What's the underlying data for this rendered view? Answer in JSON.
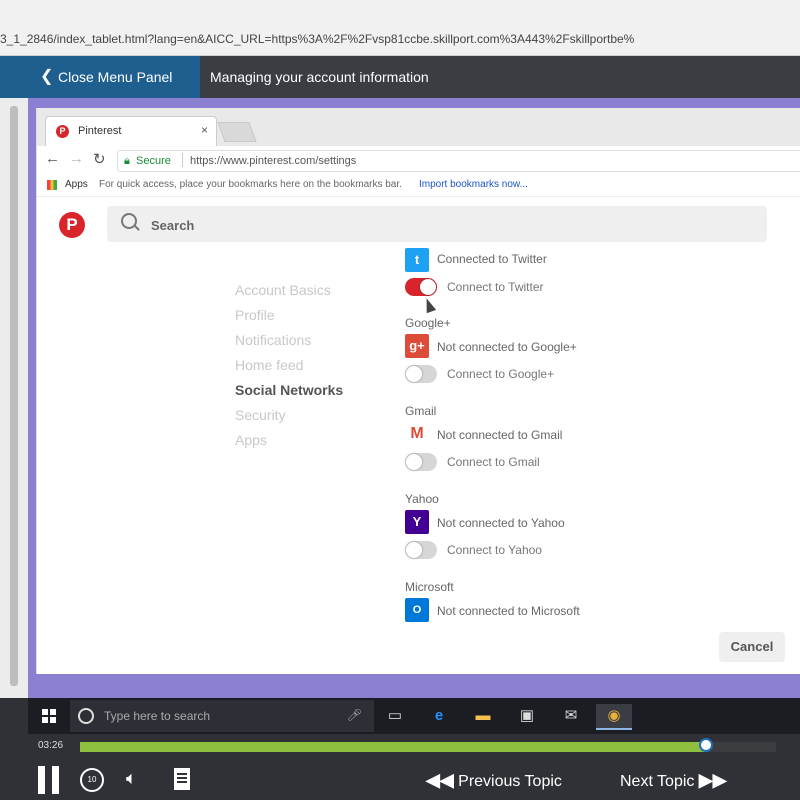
{
  "browser": {
    "url": "3_1_2846/index_tablet.html?lang=en&AICC_URL=https%3A%2F%2Fvsp81ccbe.skillport.com%3A443%2Fskillportbe%"
  },
  "course": {
    "close_menu_label": "Close Menu Panel",
    "title": "Managing your account information"
  },
  "inner_browser": {
    "tab_title": "Pinterest",
    "tab_close": "×",
    "secure_label": "Secure",
    "address": "https://www.pinterest.com/settings",
    "apps_label": "Apps",
    "bookmarks_hint": "For quick access, place your bookmarks here on the bookmarks bar.",
    "import_link": "Import bookmarks now..."
  },
  "pinterest": {
    "logo": "P",
    "search_placeholder": "Search",
    "menu": [
      {
        "label": "Account Basics"
      },
      {
        "label": "Profile"
      },
      {
        "label": "Notifications"
      },
      {
        "label": "Home feed"
      },
      {
        "label": "Social Networks",
        "active": true
      },
      {
        "label": "Security"
      },
      {
        "label": "Apps"
      }
    ],
    "networks": {
      "twitter_status": "Connected to Twitter",
      "twitter_toggle": "Connect to Twitter",
      "google_head": "Google+",
      "google_status": "Not connected to Google+",
      "google_toggle": "Connect to Google+",
      "gmail_head": "Gmail",
      "gmail_status": "Not connected to Gmail",
      "gmail_toggle": "Connect to Gmail",
      "yahoo_head": "Yahoo",
      "yahoo_status": "Not connected to Yahoo",
      "yahoo_toggle": "Connect to Yahoo",
      "microsoft_head": "Microsoft",
      "microsoft_status": "Not connected to Microsoft"
    },
    "toggles": {
      "twitter": true,
      "google": false,
      "gmail": false,
      "yahoo": false
    },
    "cancel_label": "Cancel",
    "colors": {
      "brand": "#d8252b",
      "twitter": "#1da1f2",
      "google": "#dd4b39",
      "yahoo": "#410093",
      "microsoft": "#0078d7"
    }
  },
  "taskbar": {
    "search_placeholder": "Type here to search"
  },
  "player": {
    "time": "03:26",
    "progress": 0.9,
    "replay_label": "10",
    "prev_label": "Previous Topic",
    "next_label": "Next Topic"
  }
}
